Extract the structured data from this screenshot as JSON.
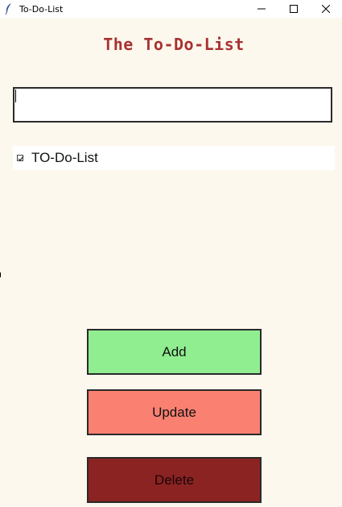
{
  "window": {
    "title": "To-Do-List",
    "controls": {
      "minimize": "—",
      "maximize": "☐",
      "close": "✕"
    }
  },
  "app": {
    "heading": "The To-Do-List",
    "entry": {
      "value": ""
    },
    "list_items": [
      {
        "label": "TO-Do-List",
        "checked": true
      }
    ],
    "buttons": {
      "add": "Add",
      "update": "Update",
      "delete": "Delete"
    }
  },
  "colors": {
    "background": "#fdf8ee",
    "heading": "#a83232",
    "add": "#90ee90",
    "update": "#fa8072",
    "delete": "#8b2323"
  }
}
